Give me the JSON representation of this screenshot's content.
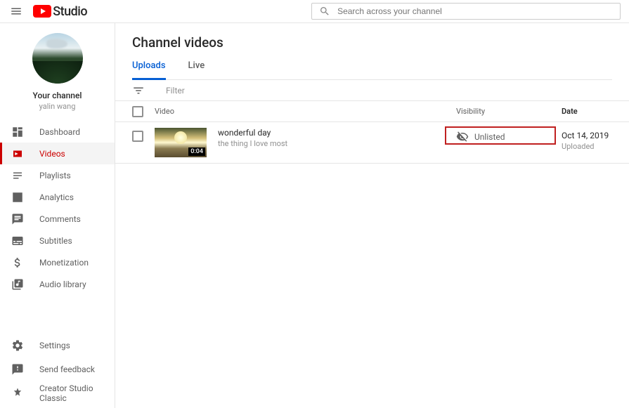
{
  "header": {
    "logo_text": "Studio",
    "search_placeholder": "Search across your channel"
  },
  "channel": {
    "your_channel_label": "Your channel",
    "name": "yalin wang"
  },
  "nav": {
    "dashboard": "Dashboard",
    "videos": "Videos",
    "playlists": "Playlists",
    "analytics": "Analytics",
    "comments": "Comments",
    "subtitles": "Subtitles",
    "monetization": "Monetization",
    "audio_library": "Audio library",
    "settings": "Settings",
    "send_feedback": "Send feedback",
    "creator_classic": "Creator Studio Classic"
  },
  "main": {
    "title": "Channel videos",
    "tabs": {
      "uploads": "Uploads",
      "live": "Live"
    },
    "filter_label": "Filter",
    "columns": {
      "video": "Video",
      "visibility": "Visibility",
      "date": "Date"
    },
    "videos": [
      {
        "title": "wonderful day",
        "subtitle": "the thing I love most",
        "duration": "0:04",
        "visibility": "Unlisted",
        "date": "Oct 14, 2019",
        "date_sub": "Uploaded"
      }
    ]
  }
}
